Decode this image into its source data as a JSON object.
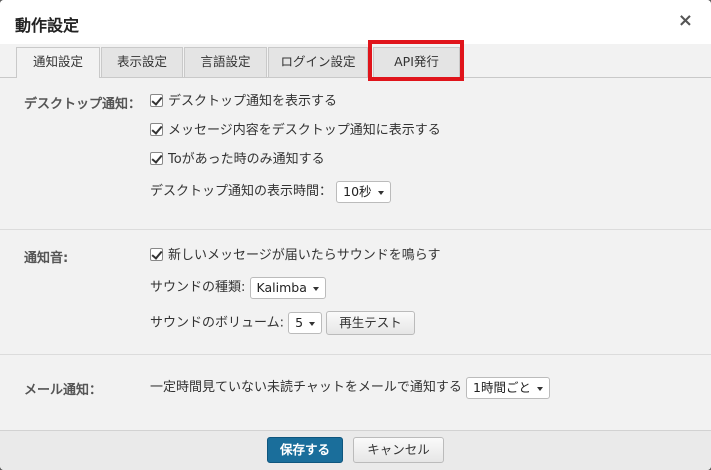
{
  "dialog": {
    "title": "動作設定",
    "close_icon": "×"
  },
  "tabs": [
    {
      "label": "通知設定",
      "active": true
    },
    {
      "label": "表示設定",
      "active": false
    },
    {
      "label": "言語設定",
      "active": false
    },
    {
      "label": "ログイン設定",
      "active": false
    },
    {
      "label": "API発行",
      "active": false
    }
  ],
  "desktop": {
    "label": "デスクトップ通知：",
    "options": [
      {
        "label": "デスクトップ通知を表示する",
        "checked": true
      },
      {
        "label": "メッセージ内容をデスクトップ通知に表示する",
        "checked": true
      },
      {
        "label": "Toがあった時のみ通知する",
        "checked": true
      }
    ],
    "duration_label": "デスクトップ通知の表示時間：",
    "duration_value": "10秒"
  },
  "sound": {
    "label": "通知音:",
    "option": {
      "label": "新しいメッセージが届いたらサウンドを鳴らす",
      "checked": true
    },
    "type_label": "サウンドの種類:",
    "type_value": "Kalimba",
    "volume_label": "サウンドのボリューム:",
    "volume_value": "5",
    "test_button": "再生テスト"
  },
  "mail": {
    "label": "メール通知：",
    "text": "一定時間見ていない未読チャットをメールで通知する",
    "interval_value": "1時間ごと"
  },
  "footer": {
    "save": "保存する",
    "cancel": "キャンセル"
  },
  "colors": {
    "primary": "#1a6e9b",
    "highlight": "#e0141b"
  }
}
